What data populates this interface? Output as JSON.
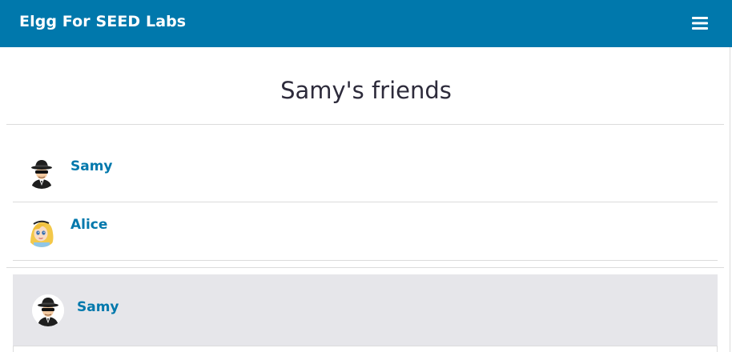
{
  "header": {
    "site_title": "Elgg For SEED Labs",
    "background_color": "#0078ac",
    "menu_icon": "hamburger-menu-icon"
  },
  "page": {
    "title": "Samy's friends"
  },
  "friends": [
    {
      "name": "Samy",
      "avatar_icon": "spy-avatar-icon"
    },
    {
      "name": "Alice",
      "avatar_icon": "alice-avatar-icon"
    }
  ],
  "owner_block": {
    "name": "Samy",
    "avatar_icon": "spy-avatar-icon",
    "background_color": "#e6e6ea"
  },
  "link_color": "#0078ac"
}
